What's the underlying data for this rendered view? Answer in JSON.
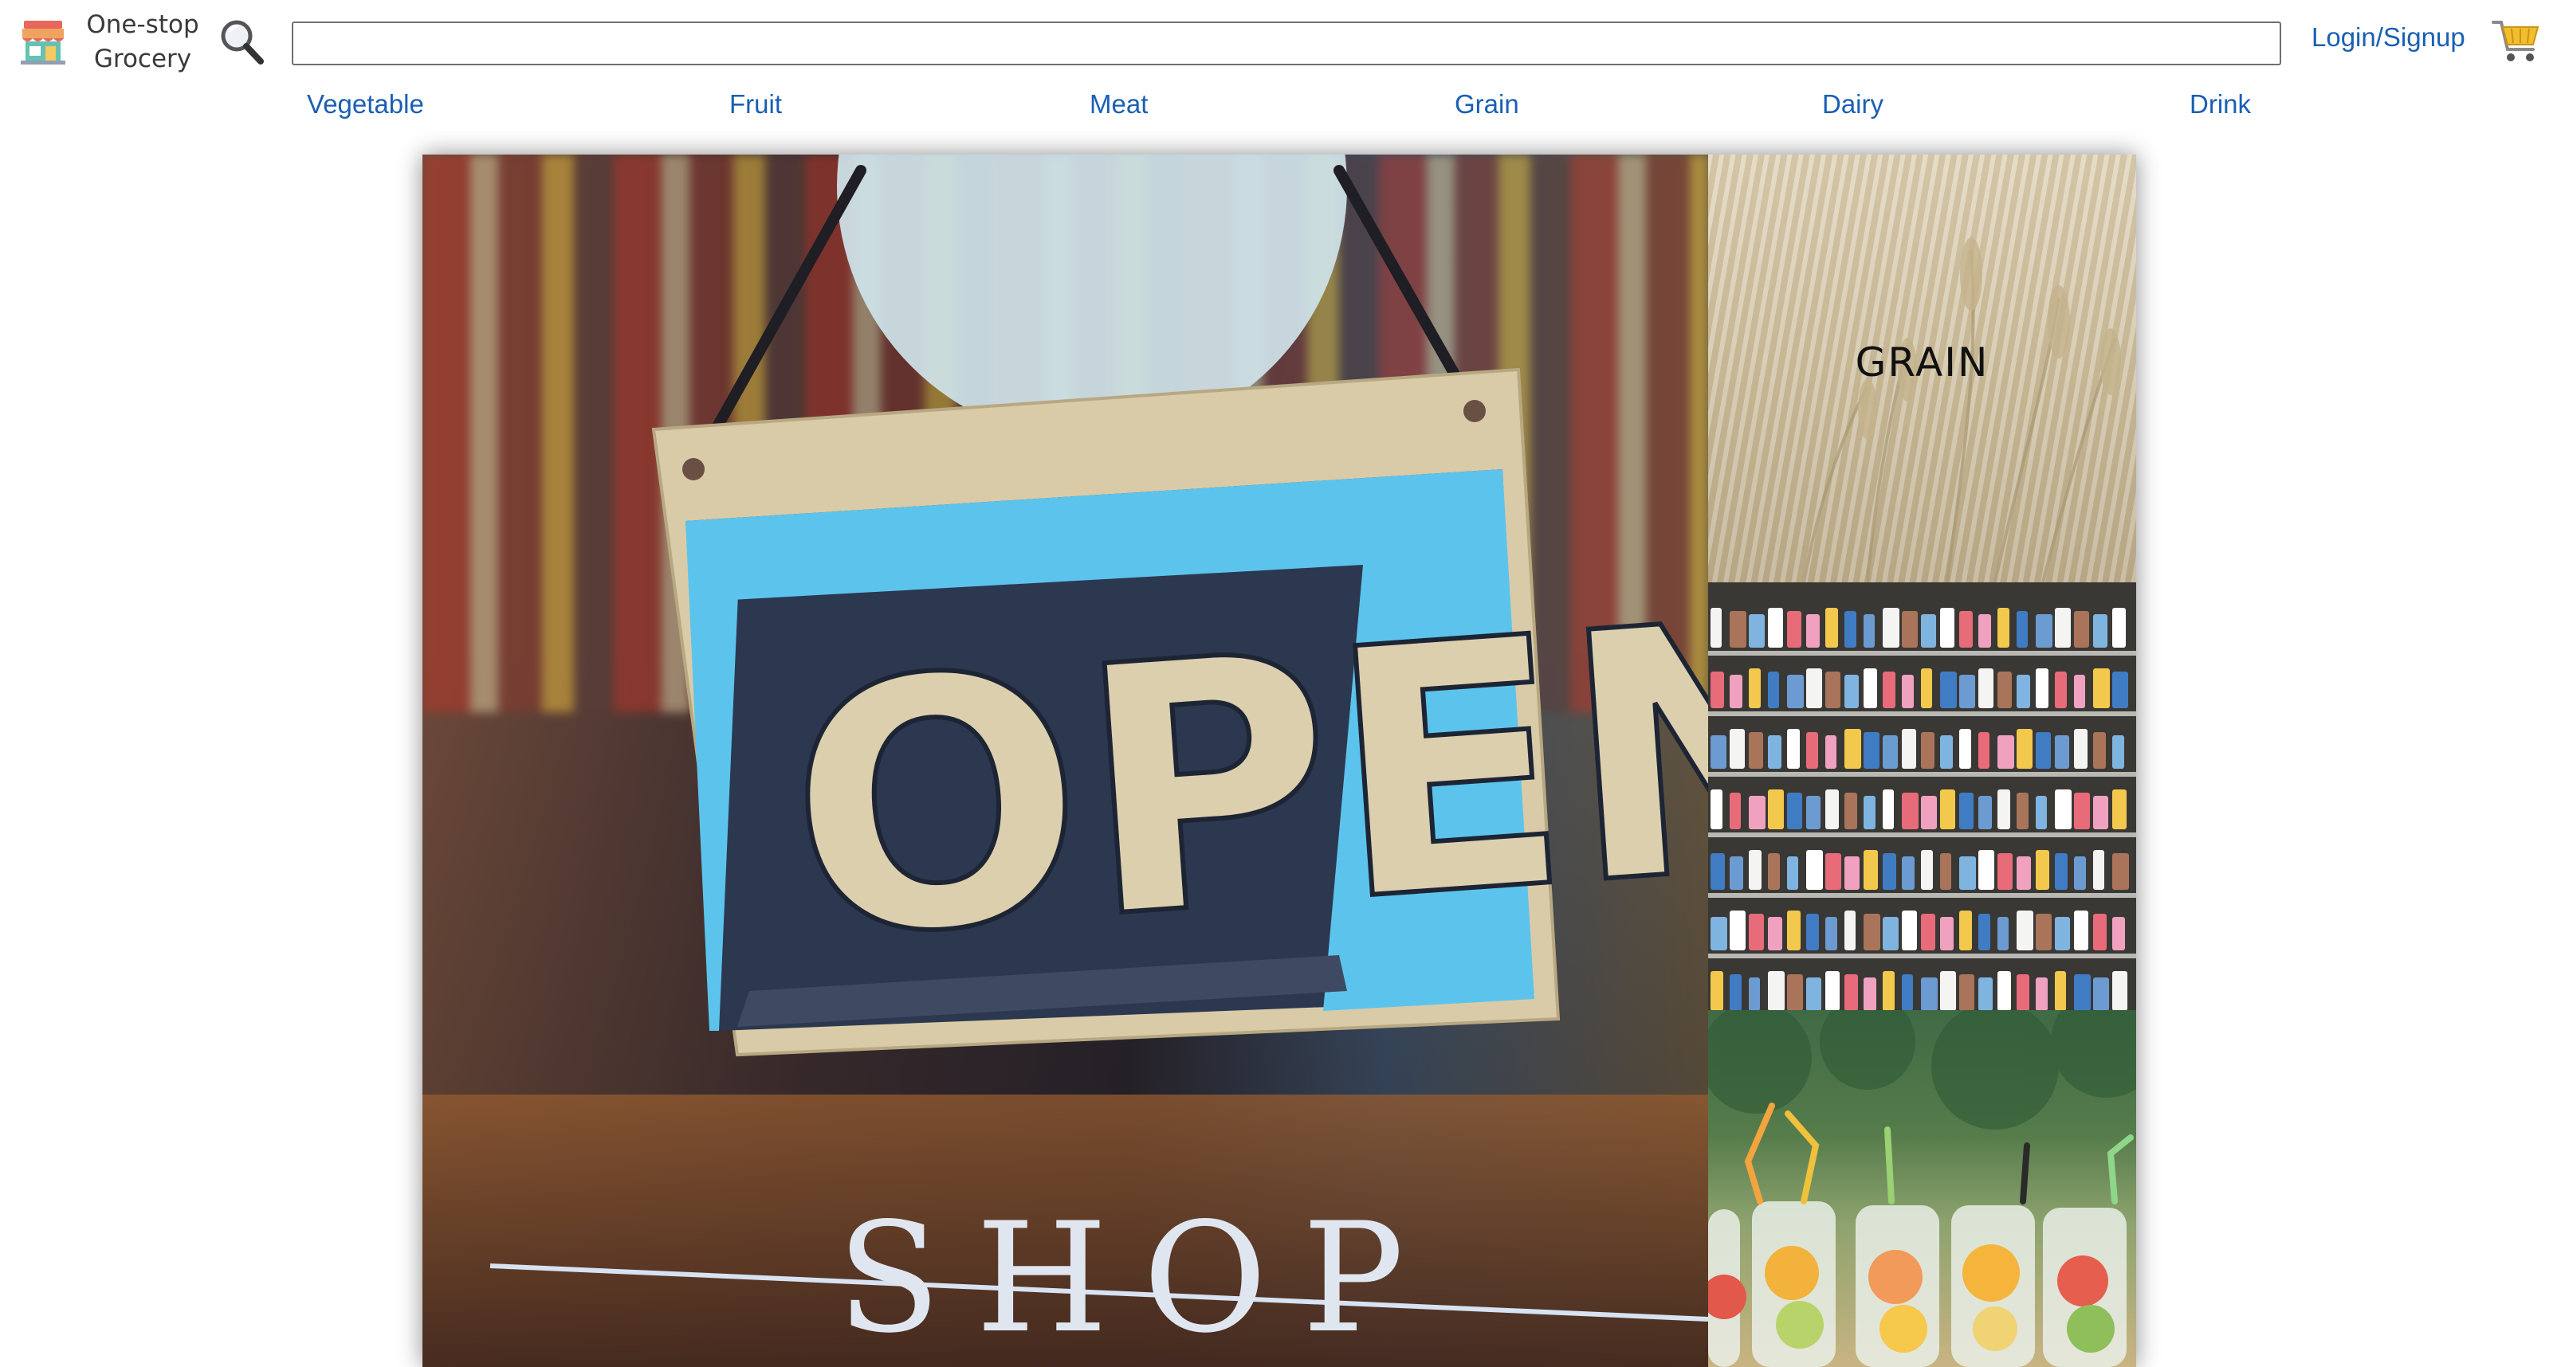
{
  "header": {
    "brand_line1": "One-stop",
    "brand_line2": "Grocery",
    "search_placeholder": "",
    "login_label": "Login/Signup",
    "icons": {
      "logo": "storefront-icon",
      "search": "magnifier-icon",
      "cart": "cart-icon"
    }
  },
  "categories": [
    "Vegetable",
    "Fruit",
    "Meat",
    "Grain",
    "Dairy",
    "Drink"
  ],
  "hero": {
    "main_sign_text": "OPEN",
    "main_window_text": "SHOP",
    "side_labels": {
      "grain": "GRAIN"
    }
  },
  "colors": {
    "link": "#1a5fb4",
    "sign_blue": "#5cc4ec",
    "sign_navy": "#2c3850",
    "sign_tan": "#d9cba8"
  }
}
